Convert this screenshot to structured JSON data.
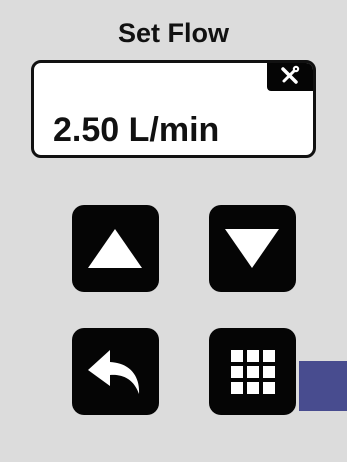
{
  "header": {
    "title": "Set Flow"
  },
  "display": {
    "value": "2.50 L/min",
    "settings_icon": "wrench-screwdriver-icon"
  },
  "buttons": {
    "increase_icon": "triangle-up-icon",
    "decrease_icon": "triangle-down-icon",
    "back_icon": "undo-arrow-icon",
    "keypad_icon": "keypad-grid-icon"
  },
  "colors": {
    "background": "#dcdcdc",
    "button": "#050505",
    "display_background": "#ffffff",
    "accent_block": "#484c8f"
  }
}
